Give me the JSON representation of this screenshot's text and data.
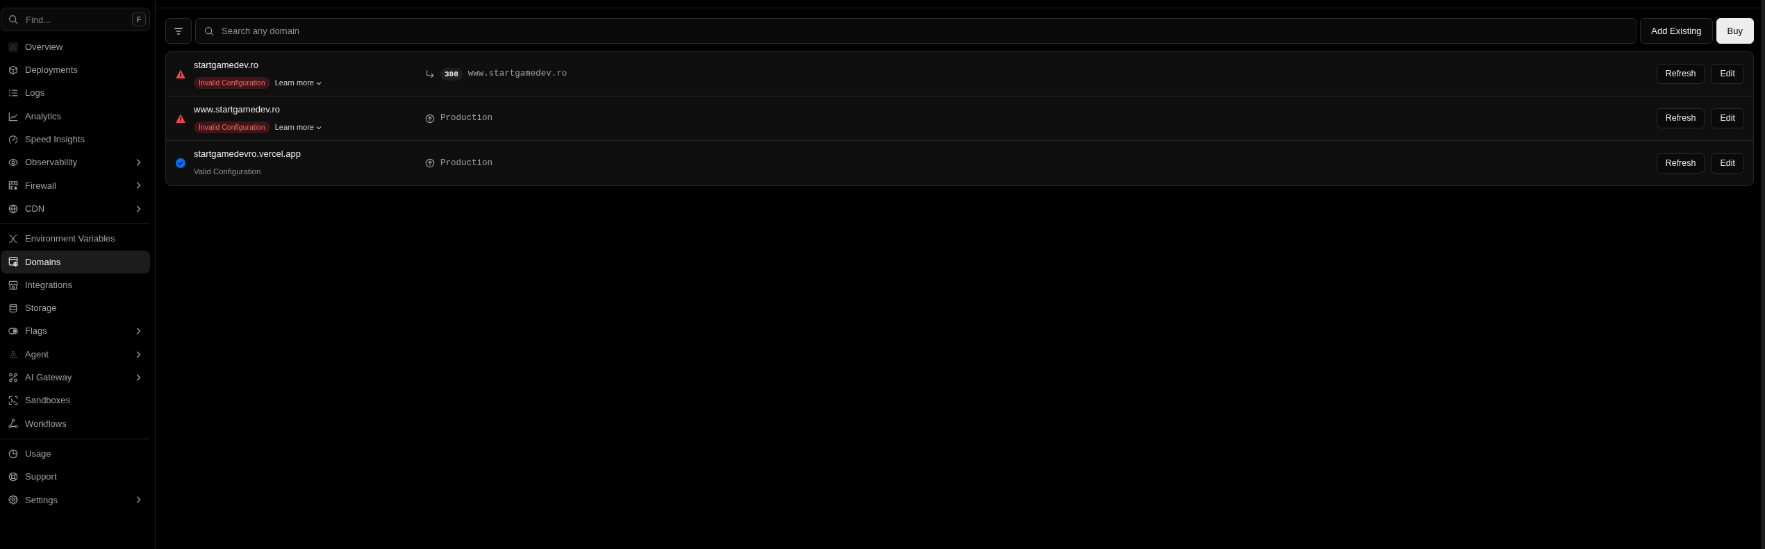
{
  "sidebar": {
    "search": {
      "placeholder": "Find...",
      "shortcut": "F"
    },
    "groups": [
      {
        "items": [
          {
            "label": "Overview",
            "selected": false,
            "has_submenu": false
          },
          {
            "label": "Deployments",
            "selected": false,
            "has_submenu": false
          },
          {
            "label": "Logs",
            "selected": false,
            "has_submenu": false
          },
          {
            "label": "Analytics",
            "selected": false,
            "has_submenu": false
          },
          {
            "label": "Speed Insights",
            "selected": false,
            "has_submenu": false
          },
          {
            "label": "Observability",
            "selected": false,
            "has_submenu": true
          },
          {
            "label": "Firewall",
            "selected": false,
            "has_submenu": true
          },
          {
            "label": "CDN",
            "selected": false,
            "has_submenu": true
          }
        ]
      },
      {
        "items": [
          {
            "label": "Environment Variables",
            "selected": false,
            "has_submenu": false
          },
          {
            "label": "Domains",
            "selected": true,
            "has_submenu": false
          },
          {
            "label": "Integrations",
            "selected": false,
            "has_submenu": false
          },
          {
            "label": "Storage",
            "selected": false,
            "has_submenu": false
          },
          {
            "label": "Flags",
            "selected": false,
            "has_submenu": true
          },
          {
            "label": "Agent",
            "selected": false,
            "has_submenu": true
          },
          {
            "label": "AI Gateway",
            "selected": false,
            "has_submenu": true
          },
          {
            "label": "Sandboxes",
            "selected": false,
            "has_submenu": false
          },
          {
            "label": "Workflows",
            "selected": false,
            "has_submenu": false
          }
        ]
      },
      {
        "items": [
          {
            "label": "Usage",
            "selected": false,
            "has_submenu": false
          },
          {
            "label": "Support",
            "selected": false,
            "has_submenu": false
          },
          {
            "label": "Settings",
            "selected": false,
            "has_submenu": true
          }
        ]
      }
    ]
  },
  "toolbar": {
    "search": {
      "placeholder": "Search any domain"
    },
    "buttons": [
      {
        "label": "Add Existing",
        "kind": "secondary"
      },
      {
        "label": "Buy",
        "kind": "primary"
      }
    ]
  },
  "domains": [
    {
      "name": "startgamedev.ro",
      "kind": "invalid",
      "status_text": "Invalid Configuration",
      "learn_more": "Learn more",
      "target": {
        "kind": "redirect",
        "code": "308",
        "text": "www.startgamedev.ro"
      },
      "actions": [
        "Refresh",
        "Edit"
      ]
    },
    {
      "name": "www.startgamedev.ro",
      "kind": "invalid",
      "status_text": "Invalid Configuration",
      "learn_more": "Learn more",
      "target": {
        "kind": "production",
        "text": "Production"
      },
      "actions": [
        "Refresh",
        "Edit"
      ]
    },
    {
      "name": "startgamedevro.vercel.app",
      "kind": "valid",
      "status_text": "Valid Configuration",
      "target": {
        "kind": "production",
        "text": "Production"
      },
      "actions": [
        "Refresh",
        "Edit"
      ]
    }
  ]
}
